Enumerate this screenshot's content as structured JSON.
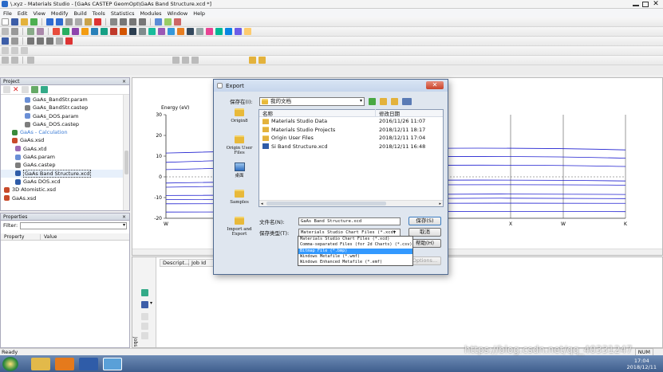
{
  "app": {
    "title": "\\.xyz - Materials Studio - [GaAs CASTEP GeomOpt\\GaAs Band Structure.xcd *]",
    "menu": [
      "File",
      "Edit",
      "View",
      "Modify",
      "Build",
      "Tools",
      "Statistics",
      "Modules",
      "Window",
      "Help"
    ],
    "status": "Ready",
    "num": "NUM"
  },
  "project": {
    "title": "Project",
    "items": [
      {
        "label": "GaAs_BandStr.param",
        "indent": 30,
        "icon": "param",
        "selected": false
      },
      {
        "label": "GaAs_BandStr.castep",
        "indent": 30,
        "icon": "castep",
        "selected": false
      },
      {
        "label": "GaAs_DOS.param",
        "indent": 30,
        "icon": "param",
        "selected": false
      },
      {
        "label": "GaAs_DOS.castep",
        "indent": 30,
        "icon": "castep",
        "selected": false
      },
      {
        "label": "GaAs - Calculation",
        "indent": 14,
        "icon": "calc",
        "selected": false,
        "color": "#3a7bd5"
      },
      {
        "label": "GaAs.xsd",
        "indent": 14,
        "icon": "xsd",
        "selected": false
      },
      {
        "label": "GaAs.xtd",
        "indent": 18,
        "icon": "xtd",
        "selected": false
      },
      {
        "label": "GaAs.param",
        "indent": 18,
        "icon": "param",
        "selected": false
      },
      {
        "label": "GaAs.castep",
        "indent": 18,
        "icon": "castep",
        "selected": false
      },
      {
        "label": "GaAs Band Structure.xcd",
        "indent": 18,
        "icon": "xcd",
        "selected": true
      },
      {
        "label": "GaAs DOS.xcd",
        "indent": 18,
        "icon": "xcd",
        "selected": false
      },
      {
        "label": "3D Atomistic.xsd",
        "indent": 4,
        "icon": "xsd",
        "selected": false
      },
      {
        "label": "GaAs.xsd",
        "indent": 4,
        "icon": "xsd",
        "selected": false
      }
    ]
  },
  "properties": {
    "title": "Properties",
    "filter_label": "Filter:",
    "col_property": "Property",
    "col_value": "Value"
  },
  "jobs": {
    "cols": [
      "Descript...",
      "Job Id"
    ],
    "side_label": "Jobs"
  },
  "chart": {
    "ylabel": "Energy (eV)",
    "yticks": [
      "30",
      "20",
      "10",
      "0",
      "-10",
      "-20"
    ],
    "xticks_left": [
      "W"
    ],
    "xticks_right": [
      "X",
      "W",
      "K"
    ]
  },
  "dialog": {
    "title": "Export",
    "lookin_label": "保存在(I):",
    "lookin_value": "我的文档",
    "places": [
      {
        "label": "Origin8",
        "kind": "folder"
      },
      {
        "label": "Origin User Files",
        "kind": "folder"
      },
      {
        "label": "桌面",
        "kind": "desktop"
      },
      {
        "label": "Samples",
        "kind": "folder"
      },
      {
        "label": "Import and Export",
        "kind": "folder"
      }
    ],
    "col_name": "名称",
    "col_date": "修改日期",
    "files": [
      {
        "name": "Materials Studio Data",
        "date": "2016/11/26 11:07",
        "kind": "folder"
      },
      {
        "name": "Materials Studio Projects",
        "date": "2018/12/11 18:17",
        "kind": "folder"
      },
      {
        "name": "Origin User Files",
        "date": "2018/12/11 17:04",
        "kind": "folder"
      },
      {
        "name": "Si Band Structure.xcd",
        "date": "2018/12/11 16:48",
        "kind": "xcd"
      }
    ],
    "filename_label": "文件名(N):",
    "filename_value": "GaAs Band Structure.xcd",
    "filetype_label": "保存类型(T):",
    "filetype_value": "Materials Studio Chart Files (*.xcd)",
    "filetype_options": [
      "Materials Studio Chart Files (*.xcd)",
      "Comma-separated Files (for 2d Charts) (*.csv)",
      "Bitmap File (*.bmp)",
      "Windows Metafile (*.wmf)",
      "Windows Enhanced Metafile (*.emf)"
    ],
    "selected_option": 2,
    "save": "保存(S)",
    "cancel": "取消",
    "help": "帮助(H)",
    "options": "Options..."
  },
  "taskbar": {
    "time": "17:04",
    "date": "2018/12/11",
    "watermark": "https://blog.csdn.net/qq_40331247"
  },
  "colors": {
    "accent": "#3399ff",
    "band": "#1f1fd0",
    "titlebar": "#1a4f9b"
  }
}
